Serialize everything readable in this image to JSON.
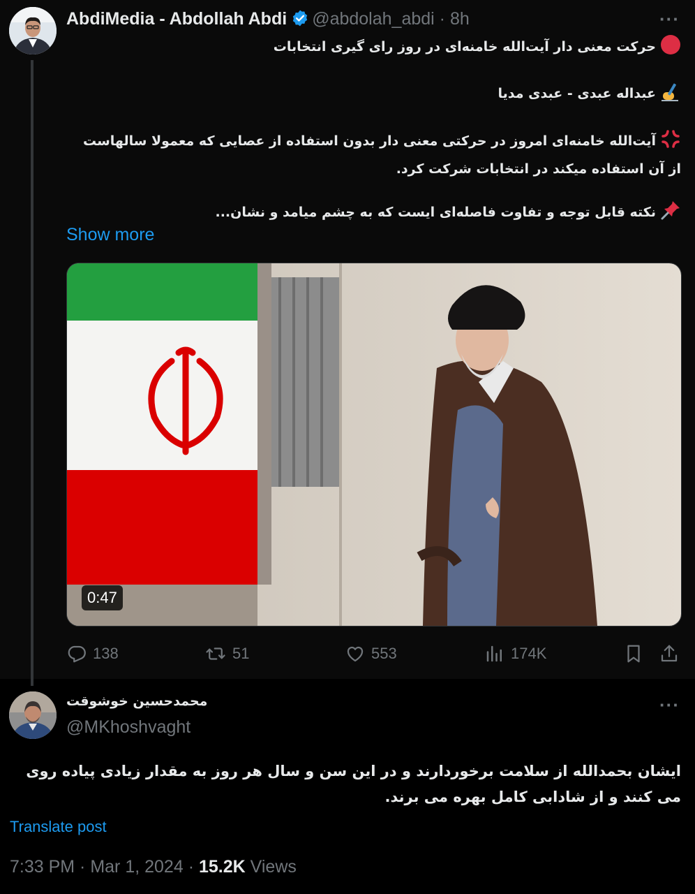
{
  "tweet": {
    "author_name": "AbdiMedia - Abdollah Abdi",
    "handle": "@abdolah_abdi",
    "time": "8h",
    "lines": [
      "حرکت معنی دار آیت‌الله خامنه‌ای در روز رای گیری انتخابات",
      "عبداله عبدی - عبدی مدیا",
      "آیت‌الله خامنه‌ای امروز در حرکتی معنی دار بدون استفاده از عصایی که معمولا سالهاست از آن استفاده میکند در انتخابات شرکت کرد.",
      "نکته قابل توجه و تفاوت فاصله‌ای ایست که به چشم میامد و نشان..."
    ],
    "show_more": "Show more",
    "video_duration": "0:47",
    "stats": {
      "replies": "138",
      "reposts": "51",
      "likes": "553",
      "views": "174K"
    }
  },
  "reply": {
    "author_name": "محمدحسین خوشوقت",
    "handle": "@MKhoshvaght",
    "body": "ایشان بحمدالله از سلامت برخوردارند و در این سن و سال هر روز به مقدار زیادی پیاده روی می کنند و از شادابی کامل بهره می برند.",
    "translate": "Translate post",
    "time": "7:33 PM",
    "date": "Mar 1, 2024",
    "views_count": "15.2K",
    "views_label": "Views"
  },
  "colors": {
    "accent": "#1d9bf0",
    "muted": "#71767b",
    "text": "#e7e9ea",
    "flag_green": "#239f40",
    "flag_red": "#da0000"
  },
  "icons": [
    "reply-icon",
    "repost-icon",
    "like-icon",
    "views-icon",
    "bookmark-icon",
    "share-icon",
    "verified-icon",
    "more-icon",
    "red-circle-icon",
    "writing-hand-icon",
    "anger-icon",
    "pushpin-icon"
  ]
}
